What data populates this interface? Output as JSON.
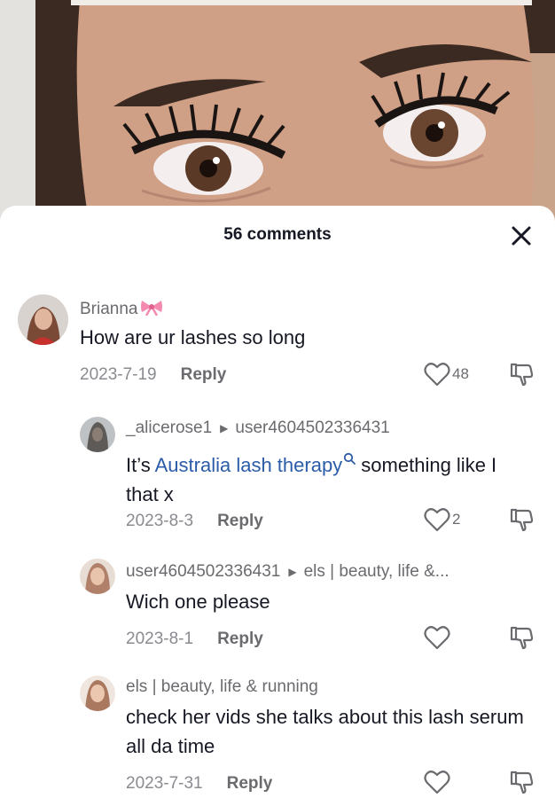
{
  "video": {
    "description_icon": "eyes-closeup-photo"
  },
  "sheet": {
    "comment_count_label": "56 comments",
    "close_icon": "close-icon"
  },
  "comments": [
    {
      "username": "Brianna",
      "username_suffix_icon": "bow-emoji",
      "text": "How are ur lashes so long",
      "date": "2023-7-19",
      "reply_label": "Reply",
      "likes": "48"
    },
    {
      "username": "_alicerose1",
      "reply_to": "user4604502336431",
      "text_before_link": "It’s ",
      "link_text": "Australia lash therapy",
      "text_after_link": " something like I that x",
      "date": "2023-8-3",
      "reply_label": "Reply",
      "likes": "2"
    },
    {
      "username": "user4604502336431",
      "reply_to": "els | beauty, life &...",
      "text": "Wich one please",
      "date": "2023-8-1",
      "reply_label": "Reply",
      "likes": ""
    },
    {
      "username": "els | beauty, life & running",
      "text": "check her vids she talks about this lash serum all da time",
      "date": "2023-7-31",
      "reply_label": "Reply",
      "likes": ""
    }
  ],
  "colors": {
    "link": "#2b5ca8",
    "text": "#161823",
    "secondary": "#6b6b6f",
    "date": "#8a8b91"
  }
}
